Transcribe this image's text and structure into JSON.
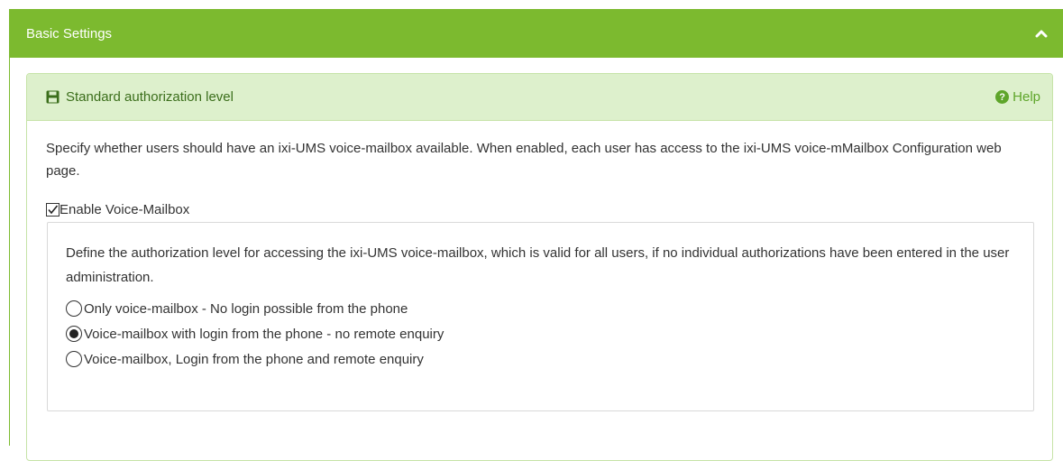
{
  "panel": {
    "title": "Basic Settings",
    "collapse_icon": "chevron-up-icon"
  },
  "section": {
    "title": "Standard authorization level",
    "title_icon": "save-icon",
    "help_label": "Help",
    "help_icon": "question-circle-icon",
    "description": "Specify whether users should have an ixi-UMS voice-mailbox available. When enabled, each user has access to the ixi-UMS voice-mMailbox Configuration web page."
  },
  "voice_mailbox": {
    "checkbox_label": "Enable Voice-Mailbox",
    "checked": true,
    "description": "Define the authorization level for accessing the ixi-UMS voice-mailbox, which is valid for all users, if no individual authorizations have been entered in the user administration.",
    "options": [
      {
        "label": "Only voice-mailbox - No login possible from the phone",
        "selected": false
      },
      {
        "label": "Voice-mailbox with login from the phone - no remote enquiry",
        "selected": true
      },
      {
        "label": "Voice-mailbox, Login from the phone and remote enquiry",
        "selected": false
      }
    ]
  },
  "colors": {
    "header_green": "#7cba2f",
    "subheader_green": "#ddf0cc",
    "help_green": "#5ea52a"
  }
}
